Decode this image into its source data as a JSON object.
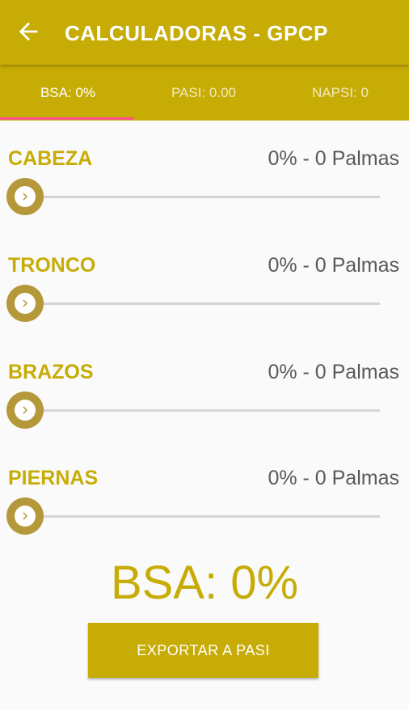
{
  "appbar": {
    "title": "CALCULADORAS - GPCP",
    "back_icon": "arrow-left-icon",
    "color": "#c7ac06"
  },
  "tabs": [
    {
      "label": "BSA: 0%",
      "active": true
    },
    {
      "label": "PASI: 0.00",
      "active": false
    },
    {
      "label": "NAPSI: 0",
      "active": false
    }
  ],
  "tab_indicator_color": "#ff4f8b",
  "regions": [
    {
      "label": "CABEZA",
      "value": "0% - 0 Palmas",
      "slider_level": 0
    },
    {
      "label": "TRONCO",
      "value": "0% - 0 Palmas",
      "slider_level": 0
    },
    {
      "label": "BRAZOS",
      "value": "0% - 0 Palmas",
      "slider_level": 0
    },
    {
      "label": "PIERNAS",
      "value": "0% - 0 Palmas",
      "slider_level": 0
    }
  ],
  "slider_thumb_icon": "chevron-right-icon",
  "total": {
    "text": "BSA: 0%"
  },
  "export_button": {
    "label": "EXPORTAR A PASI"
  }
}
